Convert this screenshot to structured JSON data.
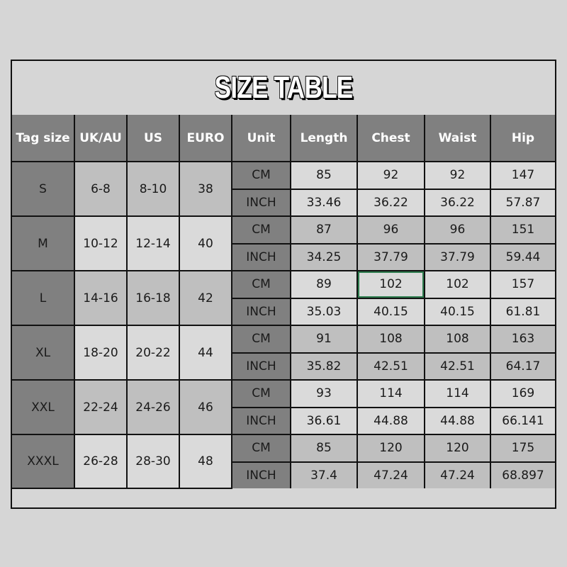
{
  "title": "SIZE TABLE",
  "headers": [
    "Tag size",
    "UK/AU",
    "US",
    "EURO",
    "Unit",
    "Length",
    "Chest",
    "Waist",
    "Hip"
  ],
  "units": [
    "CM",
    "INCH"
  ],
  "colors": {
    "header_bg": "#808080",
    "band_dark": "#bfbfbf",
    "band_light": "#dadada",
    "page_bg": "#d6d6d6",
    "selection": "#2e7d4f"
  },
  "selected_cell": {
    "size": "L",
    "unit": "CM",
    "column": "Chest"
  },
  "sizes": [
    {
      "tag": "S",
      "uk_au": "6-8",
      "us": "8-10",
      "euro": "38",
      "cm": {
        "length": "85",
        "chest": "92",
        "waist": "92",
        "hip": "147"
      },
      "inch": {
        "length": "33.46",
        "chest": "36.22",
        "waist": "36.22",
        "hip": "57.87"
      }
    },
    {
      "tag": "M",
      "uk_au": "10-12",
      "us": "12-14",
      "euro": "40",
      "cm": {
        "length": "87",
        "chest": "96",
        "waist": "96",
        "hip": "151"
      },
      "inch": {
        "length": "34.25",
        "chest": "37.79",
        "waist": "37.79",
        "hip": "59.44"
      }
    },
    {
      "tag": "L",
      "uk_au": "14-16",
      "us": "16-18",
      "euro": "42",
      "cm": {
        "length": "89",
        "chest": "102",
        "waist": "102",
        "hip": "157"
      },
      "inch": {
        "length": "35.03",
        "chest": "40.15",
        "waist": "40.15",
        "hip": "61.81"
      }
    },
    {
      "tag": "XL",
      "uk_au": "18-20",
      "us": "20-22",
      "euro": "44",
      "cm": {
        "length": "91",
        "chest": "108",
        "waist": "108",
        "hip": "163"
      },
      "inch": {
        "length": "35.82",
        "chest": "42.51",
        "waist": "42.51",
        "hip": "64.17"
      }
    },
    {
      "tag": "XXL",
      "uk_au": "22-24",
      "us": "24-26",
      "euro": "46",
      "cm": {
        "length": "93",
        "chest": "114",
        "waist": "114",
        "hip": "169"
      },
      "inch": {
        "length": "36.61",
        "chest": "44.88",
        "waist": "44.88",
        "hip": "66.141"
      }
    },
    {
      "tag": "XXXL",
      "uk_au": "26-28",
      "us": "28-30",
      "euro": "48",
      "cm": {
        "length": "85",
        "chest": "120",
        "waist": "120",
        "hip": "175"
      },
      "inch": {
        "length": "37.4",
        "chest": "47.24",
        "waist": "47.24",
        "hip": "68.897"
      }
    }
  ]
}
